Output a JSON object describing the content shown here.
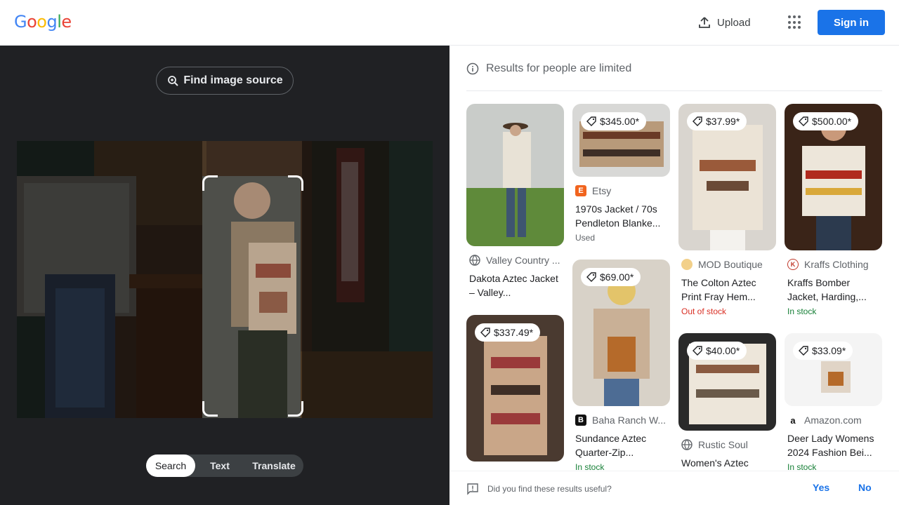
{
  "header": {
    "logo_letters": [
      "G",
      "o",
      "o",
      "g",
      "l",
      "e"
    ],
    "logo_colors": [
      "#4285f4",
      "#ea4335",
      "#fbbc05",
      "#4285f4",
      "#34a853",
      "#ea4335"
    ],
    "upload_label": "Upload",
    "signin_label": "Sign in"
  },
  "lens": {
    "find_source_label": "Find image source",
    "modes": [
      "Search",
      "Text",
      "Translate"
    ],
    "active_mode": "Search"
  },
  "results": {
    "notice": "Results for people are limited",
    "items": [
      {
        "source": "Valley Country ...",
        "title": "Dakota Aztec Jacket – Valley...",
        "price": "",
        "status": "",
        "favicon": "globe-icon"
      },
      {
        "source": "Etsy",
        "title": "1970s Jacket / 70s Pendleton Blanke...",
        "price": "$345.00*",
        "status": "Used",
        "favicon": "etsy-icon"
      },
      {
        "source": "MOD Boutique",
        "title": "The Colton Aztec Print Fray Hem...",
        "price": "$37.99*",
        "status": "Out of stock",
        "favicon": "mod-boutique-icon"
      },
      {
        "source": "Kraffs Clothing",
        "title": "Kraffs Bomber Jacket, Harding,...",
        "price": "$500.00*",
        "status": "In stock",
        "favicon": "kraffs-icon"
      },
      {
        "source": "",
        "title": "",
        "price": "$337.49*",
        "status": "",
        "favicon": ""
      },
      {
        "source": "Baha Ranch W...",
        "title": "Sundance Aztec Quarter-Zip...",
        "price": "$69.00*",
        "status": "In stock",
        "favicon": "baha-ranch-icon"
      },
      {
        "source": "Rustic Soul",
        "title": "Women's Aztec",
        "price": "$40.00*",
        "status": "",
        "favicon": "globe-icon"
      },
      {
        "source": "Amazon.com",
        "title": "Deer Lady Womens 2024 Fashion Bei...",
        "price": "$33.09*",
        "status": "In stock",
        "favicon": "amazon-icon"
      }
    ]
  },
  "feedback": {
    "question": "Did you find these results useful?",
    "yes": "Yes",
    "no": "No"
  },
  "colors": {
    "accent": "#1a73e8",
    "dark_bg": "#202124",
    "out_of_stock": "#d93025",
    "in_stock": "#188038"
  }
}
